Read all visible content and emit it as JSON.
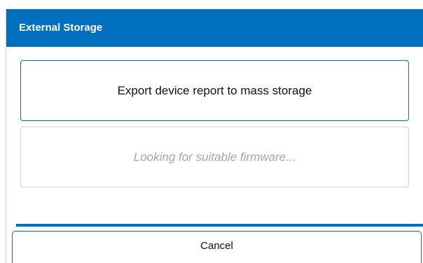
{
  "dialog": {
    "title": "External Storage",
    "options": {
      "export_label": "Export device report to mass storage",
      "firmware_status": "Looking for suitable firmware..."
    },
    "cancel_label": "Cancel"
  },
  "colors": {
    "accent": "#0070be",
    "disabled_text": "#a6a6a6",
    "disabled_border": "#cfd2d6"
  }
}
